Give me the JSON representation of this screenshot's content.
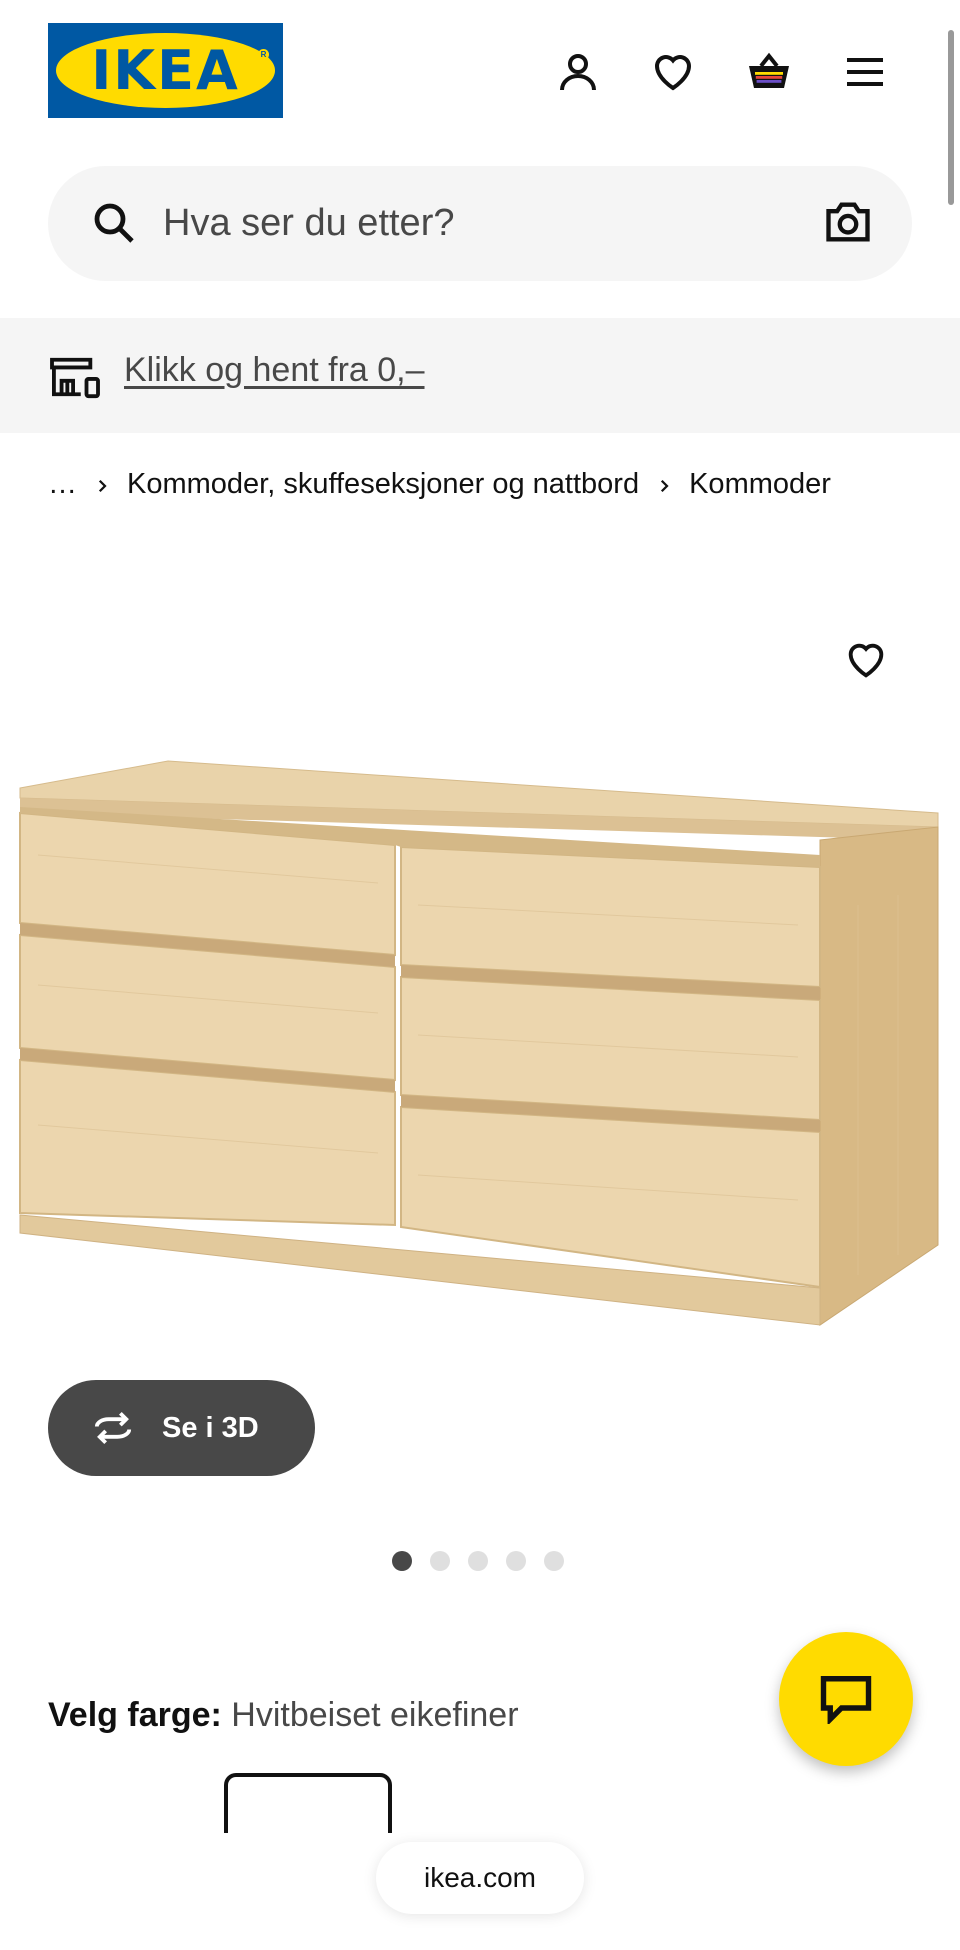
{
  "header": {
    "logo_text": "IKEA",
    "icons": [
      "user-icon",
      "heart-icon",
      "basket-icon",
      "menu-icon"
    ]
  },
  "search": {
    "placeholder": "Hva ser du etter?",
    "icons": [
      "search-icon",
      "camera-icon"
    ]
  },
  "promo": {
    "link_text": "Klikk og hent fra 0,–",
    "icon": "store-pickup-icon"
  },
  "breadcrumb": {
    "items": [
      "…",
      "Kommoder, skuffeseksjoner og nattbord",
      "Kommoder"
    ]
  },
  "product": {
    "view_3d_label": "Se i 3D",
    "image_count": 5,
    "active_image": 1,
    "color_label": "Velg farge:",
    "color_value": "Hvitbeiset eikefiner"
  },
  "footer": {
    "url": "ikea.com"
  },
  "colors": {
    "ikea_blue": "#0058a3",
    "ikea_yellow": "#ffdb00",
    "dark_gray": "#484848",
    "light_gray": "#f5f5f5",
    "wood_light": "#ecd6ae",
    "wood_mid": "#dcc194"
  }
}
